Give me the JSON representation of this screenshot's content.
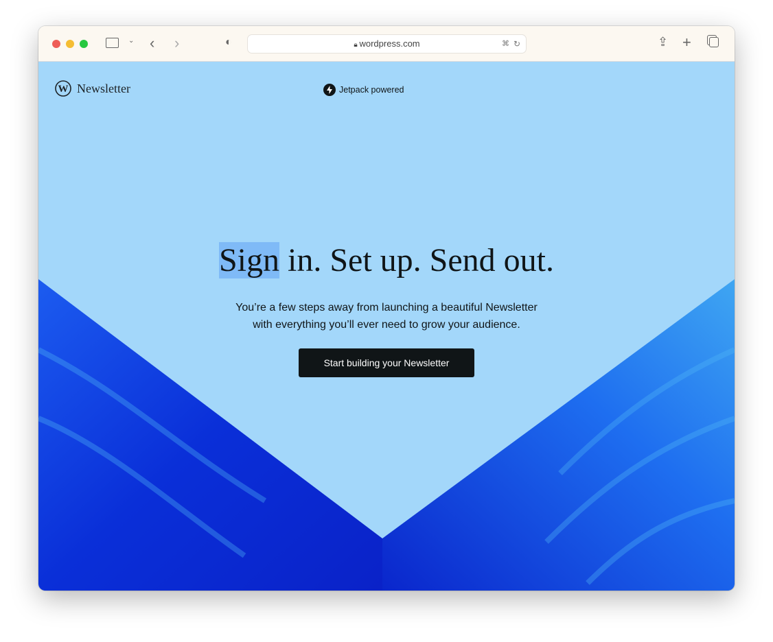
{
  "browser": {
    "url": "wordpress.com",
    "colors": {
      "close": "#ee5d57",
      "minimize": "#f5bd33",
      "maximize": "#27c840"
    }
  },
  "page": {
    "logo_text": "Newsletter",
    "jetpack_label": "Jetpack powered",
    "headline_highlight": "Sign",
    "headline_rest": " in. Set up. Send out.",
    "subtitle_line1": "You’re a few steps away from launching a beautiful Newsletter",
    "subtitle_line2": "with everything you’ll ever need to grow your audience.",
    "cta_label": "Start building your Newsletter",
    "colors": {
      "background": "#a3d7fa",
      "accent_blue": "#0a2ee0",
      "button": "#101517"
    }
  }
}
